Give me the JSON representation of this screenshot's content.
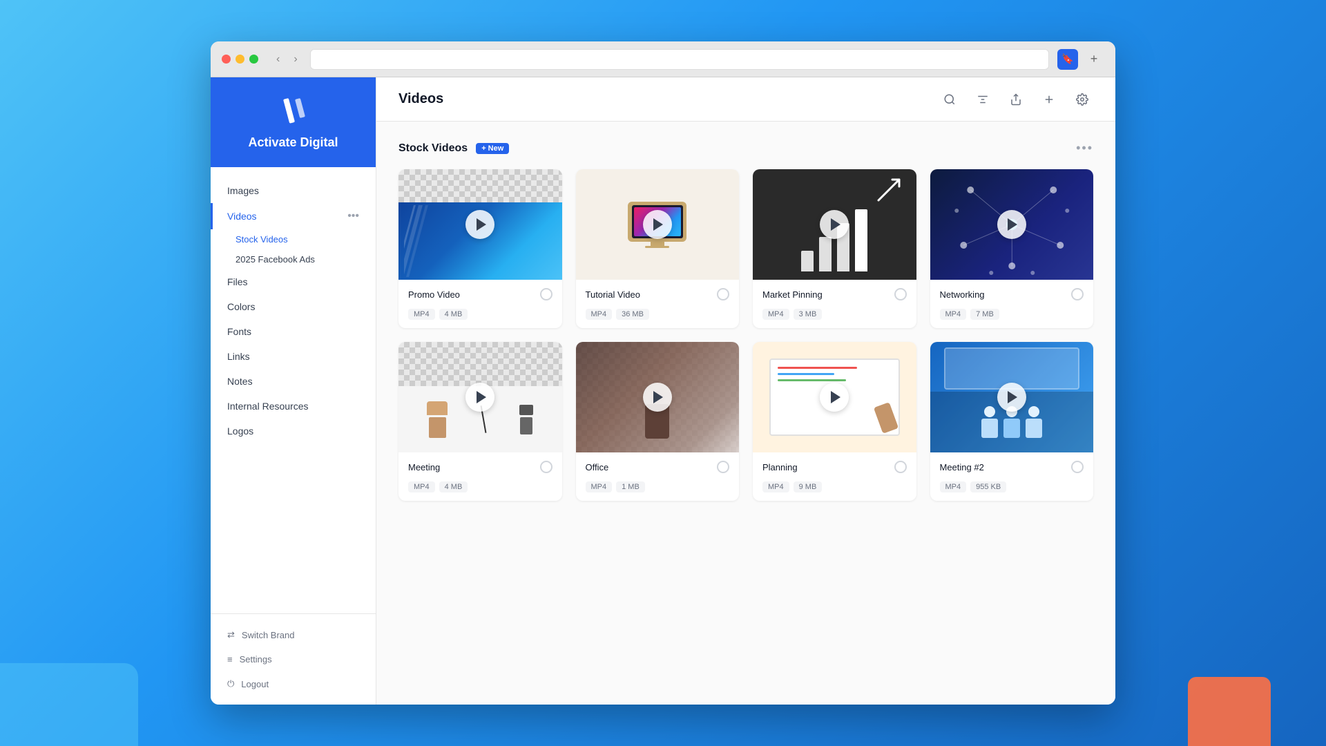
{
  "browser": {
    "address": "",
    "tab_icon": "🔖",
    "add_tab": "+"
  },
  "sidebar": {
    "brand_name": "Activate Digital",
    "logo_icon": "✏",
    "nav_items": [
      {
        "id": "images",
        "label": "Images",
        "active": false
      },
      {
        "id": "videos",
        "label": "Videos",
        "active": true
      },
      {
        "id": "files",
        "label": "Files",
        "active": false
      },
      {
        "id": "colors",
        "label": "Colors",
        "active": false
      },
      {
        "id": "fonts",
        "label": "Fonts",
        "active": false
      },
      {
        "id": "links",
        "label": "Links",
        "active": false
      },
      {
        "id": "notes",
        "label": "Notes",
        "active": false
      },
      {
        "id": "internal-resources",
        "label": "Internal Resources",
        "active": false
      },
      {
        "id": "logos",
        "label": "Logos",
        "active": false
      }
    ],
    "sub_items": [
      {
        "id": "stock-videos",
        "label": "Stock Videos",
        "active": true
      },
      {
        "id": "facebook-ads",
        "label": "2025 Facebook Ads",
        "active": false
      }
    ],
    "footer_items": [
      {
        "id": "switch-brand",
        "label": "Switch Brand",
        "icon": "⇄"
      },
      {
        "id": "settings",
        "label": "Settings",
        "icon": "≡"
      },
      {
        "id": "logout",
        "label": "Logout",
        "icon": "⏻"
      }
    ]
  },
  "main": {
    "page_title": "Videos",
    "header_icons": [
      {
        "id": "search",
        "symbol": "🔍"
      },
      {
        "id": "filter",
        "symbol": "⊟"
      },
      {
        "id": "share",
        "symbol": "⊲"
      },
      {
        "id": "add",
        "symbol": "+"
      },
      {
        "id": "settings",
        "symbol": "⚙"
      }
    ],
    "section_title": "Stock Videos",
    "new_badge_label": "+ New",
    "section_more": "•••",
    "videos": [
      {
        "id": "promo-video",
        "name": "Promo Video",
        "format": "MP4",
        "size": "4 MB",
        "thumb_type": "promo",
        "has_checkered": true
      },
      {
        "id": "tutorial-video",
        "name": "Tutorial Video",
        "format": "MP4",
        "size": "36 MB",
        "thumb_type": "tutorial",
        "has_checkered": false
      },
      {
        "id": "market-pinning",
        "name": "Market Pinning",
        "format": "MP4",
        "size": "3 MB",
        "thumb_type": "market",
        "has_checkered": false
      },
      {
        "id": "networking",
        "name": "Networking",
        "format": "MP4",
        "size": "7 MB",
        "thumb_type": "networking",
        "has_checkered": false
      },
      {
        "id": "meeting",
        "name": "Meeting",
        "format": "MP4",
        "size": "4 MB",
        "thumb_type": "meeting",
        "has_checkered": true
      },
      {
        "id": "office",
        "name": "Office",
        "format": "MP4",
        "size": "1 MB",
        "thumb_type": "office",
        "has_checkered": true
      },
      {
        "id": "planning",
        "name": "Planning",
        "format": "MP4",
        "size": "9 MB",
        "thumb_type": "planning",
        "has_checkered": false
      },
      {
        "id": "meeting2",
        "name": "Meeting #2",
        "format": "MP4",
        "size": "955 KB",
        "thumb_type": "meeting2",
        "has_checkered": false
      }
    ]
  }
}
